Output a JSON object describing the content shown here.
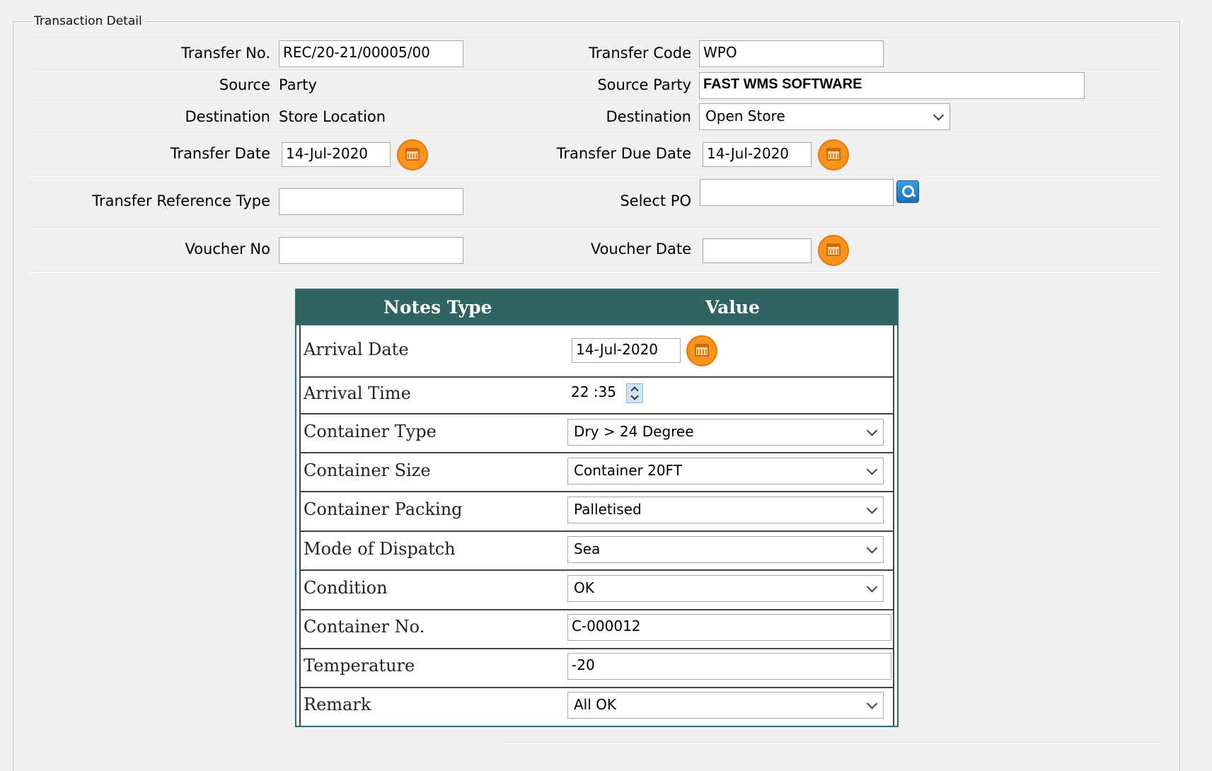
{
  "section_title": "Transaction Detail",
  "form": {
    "transfer_no_label": "Transfer No.",
    "transfer_no_value": "REC/20-21/00005/00",
    "transfer_code_label": "Transfer Code",
    "transfer_code_value": "WPO",
    "source_party_left_label": "Source",
    "source_party_left_value": "Party",
    "source_party_label": "Source Party",
    "source_party_value": "FAST WMS SOFTWARE",
    "destination_left_label": "Destination",
    "destination_left_value": "Store Location",
    "destination_label": "Destination",
    "destination_value": "Open Store",
    "transfer_date_label": "Transfer Date",
    "transfer_date_value": "14-Jul-2020",
    "transfer_due_date_label": "Transfer Due Date",
    "transfer_due_date_value": "14-Jul-2020",
    "transfer_reference_type_label": "Transfer Reference Type",
    "transfer_reference_type_value": "",
    "select_po_label": "Select PO",
    "select_po_value": "",
    "voucher_no_label": "Voucher No",
    "voucher_no_value": "",
    "voucher_date_label": "Voucher Date",
    "voucher_date_value": ""
  },
  "notes_table": {
    "headers": [
      "Notes Type",
      "Value"
    ],
    "rows": [
      {
        "label": "Arrival Date",
        "value": "14-Jul-2020"
      },
      {
        "label": "Arrival Time",
        "value": "22 :35"
      },
      {
        "label": "Container Type",
        "value": "Dry > 24 Degree"
      },
      {
        "label": "Container Size",
        "value": "Container 20FT"
      },
      {
        "label": "Container Packing",
        "value": "Palletised"
      },
      {
        "label": "Mode of Dispatch",
        "value": "Sea"
      },
      {
        "label": "Condition",
        "value": "OK"
      },
      {
        "label": "Container No.",
        "value": "C-000012"
      },
      {
        "label": "Temperature",
        "value": "-20"
      },
      {
        "label": "Remark",
        "value": "All OK"
      }
    ]
  },
  "icons": {
    "calendar": "calendar-icon",
    "search": "search-icon",
    "dropdown": "chevron-down-icon",
    "spinner": "spinner-icon"
  },
  "colors": {
    "table_header_bg": "#2f6462",
    "calendar_orange": "#f7931e",
    "search_blue": "#1a6fb5"
  }
}
